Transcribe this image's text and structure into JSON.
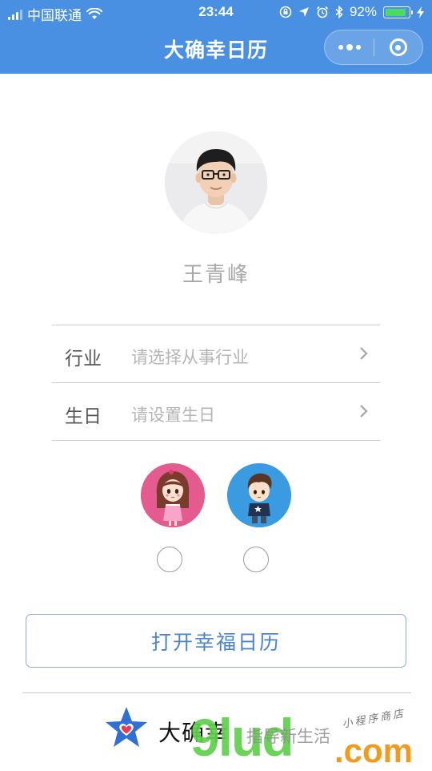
{
  "status_bar": {
    "carrier": "中国联通",
    "time": "23:44",
    "battery_percent": "92%",
    "battery_level": 0.92
  },
  "nav": {
    "title": "大确幸日历"
  },
  "profile": {
    "name": "王青峰"
  },
  "form": {
    "rows": [
      {
        "label": "行业",
        "placeholder": "请选择从事行业"
      },
      {
        "label": "生日",
        "placeholder": "请设置生日"
      }
    ]
  },
  "gender": {
    "options": [
      {
        "name": "female",
        "icon": "girl-avatar-icon",
        "color": "#e45b8f",
        "selected": false
      },
      {
        "name": "male",
        "icon": "boy-avatar-icon",
        "color": "#3b9be0",
        "selected": false
      }
    ]
  },
  "actions": {
    "open_button": "打开幸福日历"
  },
  "footer": {
    "brand_name": "大确幸",
    "watermark_big": "9lud",
    "watermark_suffix": ".com",
    "watermark_slogan": "指导新生活",
    "watermark_script": "小程序商店"
  },
  "colors": {
    "primary": "#4a90e2",
    "button_text": "#4a84c9",
    "battery_fill": "#4cd964",
    "star": "#2f6fd6",
    "heart": "#e83a55"
  }
}
